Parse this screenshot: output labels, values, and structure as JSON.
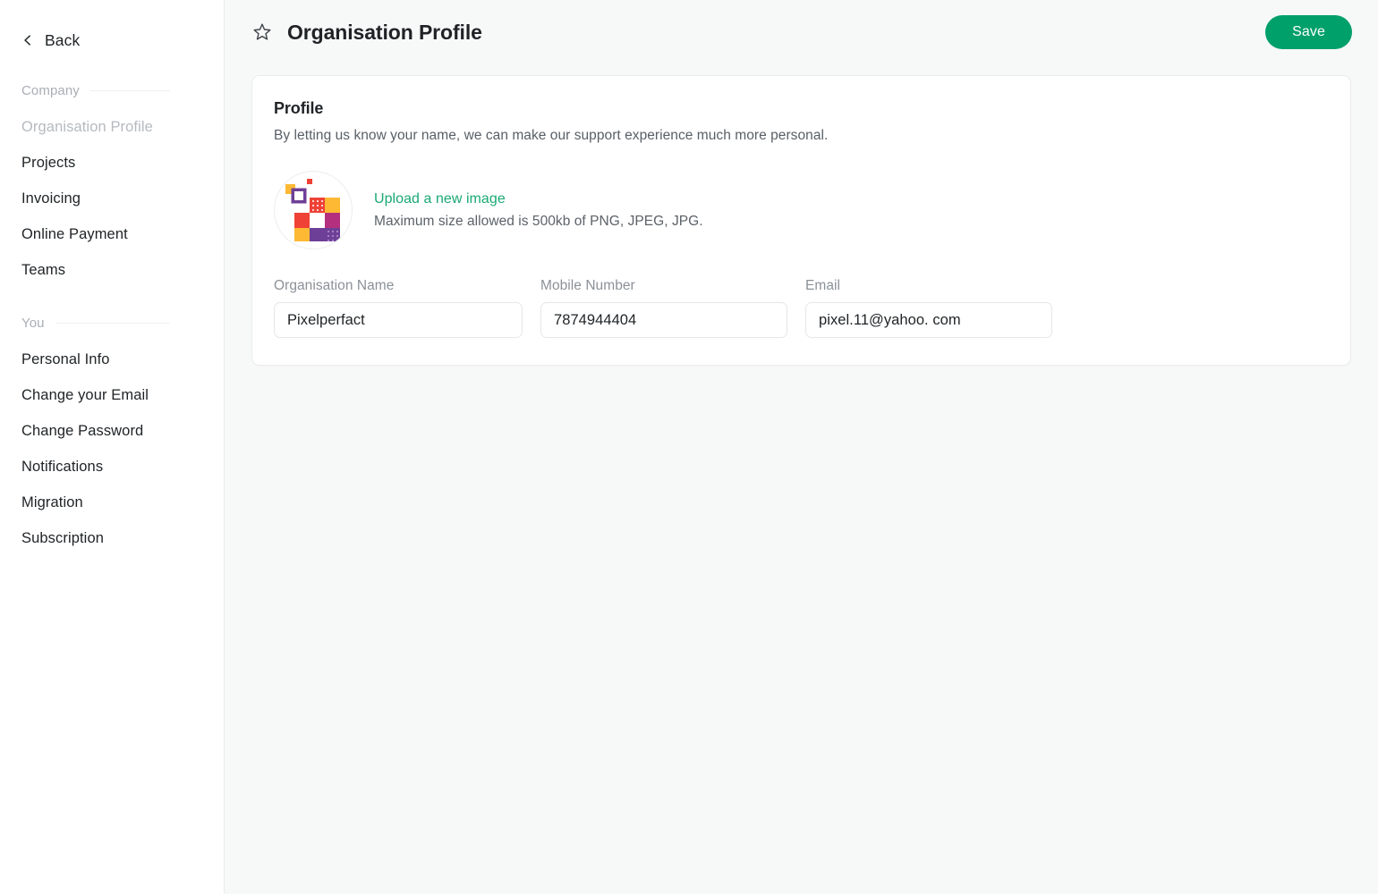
{
  "sidebar": {
    "back": {
      "label": "Back",
      "icon": "chevron-left-icon"
    },
    "sections": [
      {
        "title": "Company",
        "items": [
          {
            "label": "Organisation Profile",
            "active": true
          },
          {
            "label": "Projects",
            "active": false
          },
          {
            "label": "Invoicing",
            "active": false
          },
          {
            "label": "Online Payment",
            "active": false
          },
          {
            "label": "Teams",
            "active": false
          }
        ]
      },
      {
        "title": "You",
        "items": [
          {
            "label": "Personal Info",
            "active": false
          },
          {
            "label": "Change your Email",
            "active": false
          },
          {
            "label": "Change Password",
            "active": false
          },
          {
            "label": "Notifications",
            "active": false
          },
          {
            "label": "Migration",
            "active": false
          },
          {
            "label": "Subscription",
            "active": false
          }
        ]
      }
    ]
  },
  "topbar": {
    "favorite_icon": "star-outline-icon",
    "title": "Organisation Profile",
    "save_label": "Save"
  },
  "profile_card": {
    "title": "Profile",
    "subtitle": "By letting us know your name, we can make our support experience much more personal.",
    "avatar": {
      "icon": "organisation-logo-icon",
      "colors": {
        "red": "#ef4136",
        "orange": "#fdb933",
        "purple": "#6d3f96",
        "magenta": "#b4307f"
      }
    },
    "upload": {
      "link_label": "Upload a new image",
      "hint": "Maximum size allowed is 500kb of PNG, JPEG, JPG."
    },
    "fields": [
      {
        "label": "Organisation Name",
        "value": "Pixelperfact",
        "placeholder": "Organisation Name"
      },
      {
        "label": "Mobile Number",
        "value": "7874944404",
        "placeholder": "Mobile Number"
      },
      {
        "label": "Email",
        "value": "pixel.11@yahoo. com",
        "placeholder": "Email"
      }
    ]
  },
  "colors": {
    "accent_green": "#00a06a",
    "link_green": "#19a974",
    "page_background": "#f7f8f8",
    "sidebar_background": "#ffffff"
  }
}
